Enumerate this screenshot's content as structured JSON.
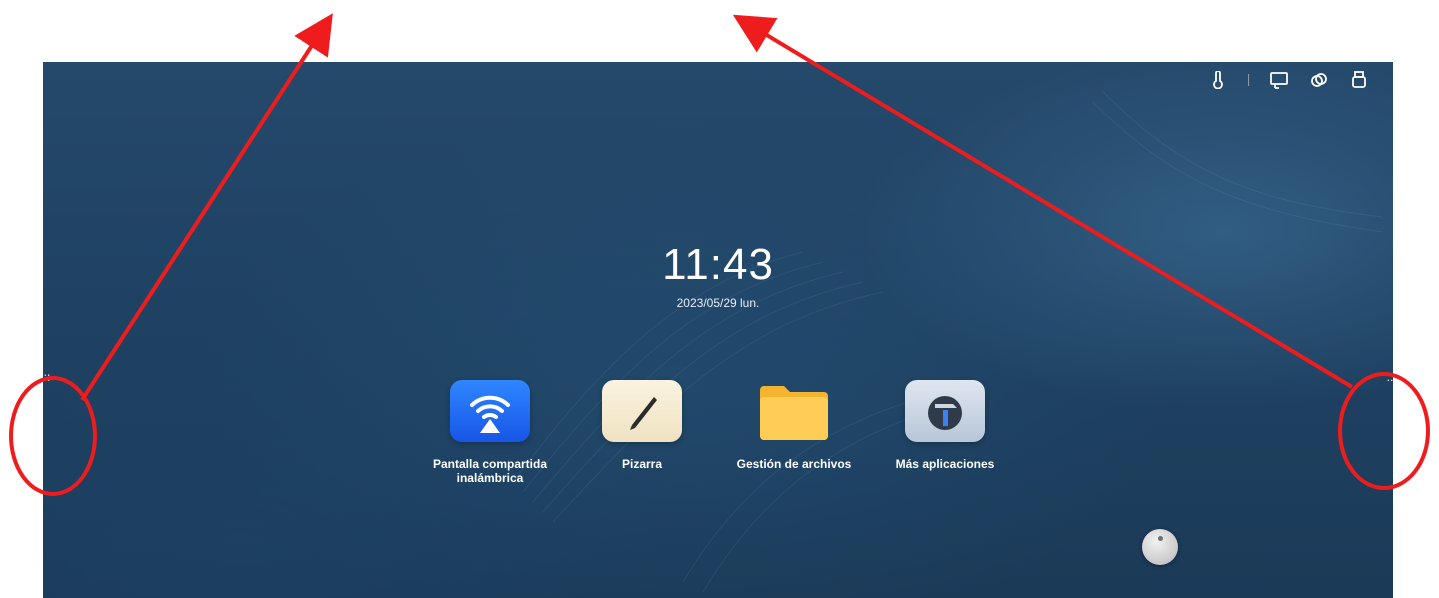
{
  "clock": {
    "time": "11:43",
    "date": "2023/05/29 lun."
  },
  "status_bar": {
    "icons": [
      "thermometer-icon",
      "screen-share-icon",
      "link-icon",
      "usb-icon"
    ]
  },
  "apps": [
    {
      "label_line1": "Pantalla compartida",
      "label_line2": "inalámbrica",
      "icon": "wireless-screen-share-icon"
    },
    {
      "label_line1": "Pizarra",
      "label_line2": "",
      "icon": "whiteboard-pen-icon"
    },
    {
      "label_line1": "Gestión de archivos",
      "label_line2": "",
      "icon": "folder-icon"
    },
    {
      "label_line1": "Más aplicaciones",
      "label_line2": "",
      "icon": "toolbox-hammer-icon"
    }
  ],
  "edge_handles": {
    "left_glyph": "::",
    "right_glyph": "::"
  },
  "colors": {
    "annotation_red": "#ee1c1c",
    "accent_blue": "#1e6cf2",
    "folder_yellow": "#ffc84a"
  }
}
